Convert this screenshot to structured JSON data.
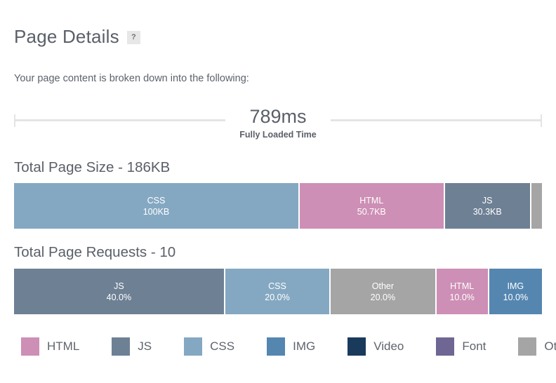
{
  "header": {
    "title": "Page Details",
    "help_badge": "?",
    "subtitle": "Your page content is broken down into the following:"
  },
  "load_time": {
    "value": "789ms",
    "label": "Fully Loaded Time"
  },
  "page_size": {
    "title": "Total Page Size - 186KB"
  },
  "page_requests": {
    "title": "Total Page Requests - 10"
  },
  "colors": {
    "HTML": "#cd8fb5",
    "JS": "#6e8094",
    "CSS": "#85a8c2",
    "IMG": "#5586b0",
    "Video": "#1a3a5c",
    "Font": "#6f6693",
    "Other": "#a5a5a5"
  },
  "legend": {
    "items": [
      {
        "label": "HTML",
        "color": "#cd8fb5"
      },
      {
        "label": "JS",
        "color": "#6e8094"
      },
      {
        "label": "CSS",
        "color": "#85a8c2"
      },
      {
        "label": "IMG",
        "color": "#5586b0"
      },
      {
        "label": "Video",
        "color": "#1a3a5c"
      },
      {
        "label": "Font",
        "color": "#6f6693"
      },
      {
        "label": "Other",
        "color": "#a5a5a5"
      }
    ]
  },
  "chart_data": [
    {
      "type": "bar",
      "orientation": "horizontal-stacked",
      "title": "Total Page Size - 186KB",
      "total": "186KB",
      "total_value": 186,
      "unit": "KB",
      "categories": [
        "CSS",
        "HTML",
        "JS",
        "Other"
      ],
      "values": [
        100,
        50.7,
        30.3,
        3.8
      ],
      "value_labels": [
        "100KB",
        "50.7KB",
        "30.3KB",
        ""
      ],
      "percents": [
        53.8,
        27.3,
        16.3,
        2.0
      ],
      "colors": [
        "#85a8c2",
        "#cd8fb5",
        "#6e8094",
        "#a5a5a5"
      ],
      "labels_visible": [
        true,
        true,
        true,
        false
      ],
      "xlabel": "",
      "ylabel": "",
      "grid": false,
      "legend_position": "bottom"
    },
    {
      "type": "bar",
      "orientation": "horizontal-stacked",
      "title": "Total Page Requests - 10",
      "total": "10",
      "total_value": 10,
      "unit": "requests",
      "categories": [
        "JS",
        "CSS",
        "Other",
        "HTML",
        "IMG"
      ],
      "values": [
        40.0,
        20.0,
        20.0,
        10.0,
        10.0
      ],
      "value_labels": [
        "40.0%",
        "20.0%",
        "20.0%",
        "10.0%",
        "10.0%"
      ],
      "percents": [
        40.0,
        20.0,
        20.0,
        10.0,
        10.0
      ],
      "colors": [
        "#6e8094",
        "#85a8c2",
        "#a5a5a5",
        "#cd8fb5",
        "#5586b0"
      ],
      "labels_visible": [
        true,
        true,
        true,
        true,
        true
      ],
      "xlabel": "",
      "ylabel": "",
      "grid": false,
      "legend_position": "bottom"
    }
  ]
}
